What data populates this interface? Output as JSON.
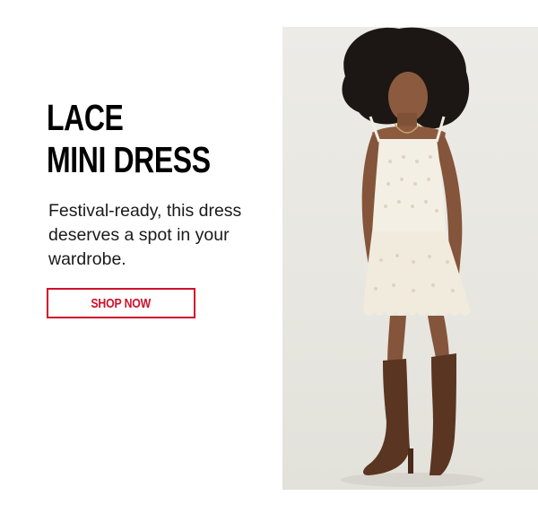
{
  "promo": {
    "headline_line1": "LACE",
    "headline_line2": "MINI DRESS",
    "body": "Festival-ready, this dress deserves a spot in your wardrobe.",
    "cta_label": "SHOP NOW"
  },
  "image": {
    "subject": "model-in-lace-mini-dress"
  },
  "colors": {
    "headline": "#000000",
    "cta_accent": "#d0112b",
    "photo_background": "#e8e7e1",
    "dress": "#f4efe4",
    "boots": "#5a3522",
    "hair": "#1c1714",
    "skin": "#8c5b3f"
  }
}
